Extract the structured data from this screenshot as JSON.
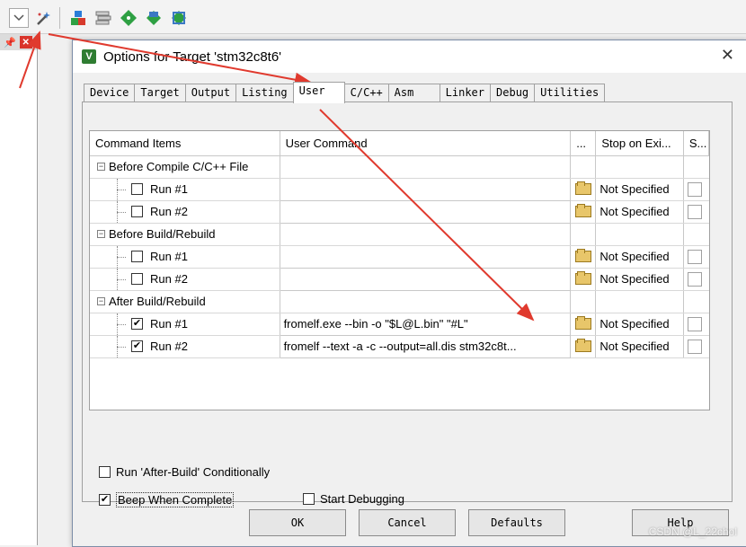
{
  "toolbar": {
    "icons": [
      "dropdown-icon",
      "options-wand-icon",
      "manage-components-icon",
      "layers-icon",
      "diamond-green-icon",
      "pack-installer-icon",
      "pack-select-icon"
    ]
  },
  "dialog": {
    "title": "Options for Target 'stm32c8t6'",
    "tabs": [
      "Device",
      "Target",
      "Output",
      "Listing",
      "User",
      "C/C++",
      "Asm",
      "Linker",
      "Debug",
      "Utilities"
    ],
    "active_tab": "User",
    "columns": [
      "Command Items",
      "User Command",
      "...",
      "Stop on Exi...",
      "S..."
    ],
    "groups": [
      {
        "label": "Before Compile C/C++ File",
        "expander": "−",
        "rows": [
          {
            "label": "Run #1",
            "checked": false,
            "command": "",
            "stop": "Not Specified"
          },
          {
            "label": "Run #2",
            "checked": false,
            "command": "",
            "stop": "Not Specified"
          }
        ]
      },
      {
        "label": "Before Build/Rebuild",
        "expander": "−",
        "rows": [
          {
            "label": "Run #1",
            "checked": false,
            "command": "",
            "stop": "Not Specified"
          },
          {
            "label": "Run #2",
            "checked": false,
            "command": "",
            "stop": "Not Specified"
          }
        ]
      },
      {
        "label": "After Build/Rebuild",
        "expander": "−",
        "rows": [
          {
            "label": "Run #1",
            "checked": true,
            "command": "fromelf.exe --bin -o \"$L@L.bin\" \"#L\"",
            "stop": "Not Specified"
          },
          {
            "label": "Run #2",
            "checked": true,
            "command": "fromelf  --text  -a -c  --output=all.dis  stm32c8t...",
            "stop": "Not Specified"
          }
        ]
      }
    ],
    "options": {
      "run_after_build": {
        "label": "Run 'After-Build' Conditionally",
        "checked": false
      },
      "beep": {
        "label": "Beep When Complete",
        "checked": true
      },
      "start_debugging": {
        "label": "Start Debugging",
        "checked": false
      }
    },
    "buttons": {
      "ok": "OK",
      "cancel": "Cancel",
      "defaults": "Defaults",
      "help": "Help"
    }
  },
  "watermark": "CSDN @L_22chol",
  "colors": {
    "arrow": "#e03a2e",
    "folder": "#e8c66a",
    "close_panel": "#d9342b"
  }
}
